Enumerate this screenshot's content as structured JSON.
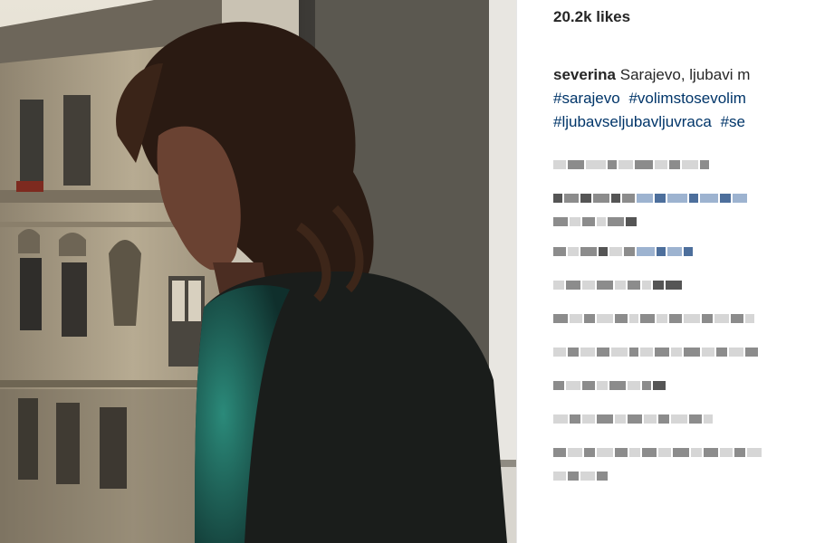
{
  "post": {
    "likes_text": "20.2k likes",
    "caption": {
      "username": "severina",
      "text": "Sarajevo, ljubavi m",
      "hashtags_line1": [
        "#sarajevo",
        "#volimstosevolim"
      ],
      "hashtags_line2": [
        "#ljubavseljubavljuvraca",
        "#se"
      ]
    },
    "comments_count_visible": 11,
    "comments_state": "pixelated"
  },
  "photo": {
    "subject": "woman-at-window"
  }
}
